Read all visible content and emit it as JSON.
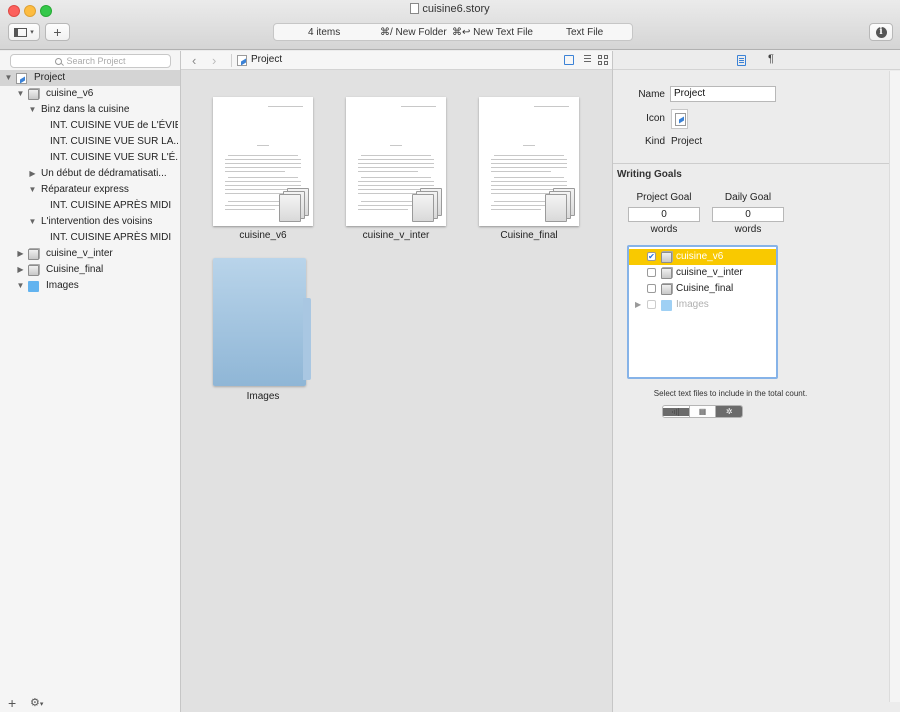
{
  "window": {
    "title": "cuisine6.story"
  },
  "toolbar": {
    "status_items": "4 items",
    "status_new_folder": "⌘/ New Folder",
    "status_new_text": "⌘↩ New Text File",
    "status_kind": "Text File",
    "add_label": "+"
  },
  "sidebar": {
    "search_placeholder": "Search Project",
    "tree": [
      {
        "label": "Project",
        "level": 0,
        "icon": "story-icon",
        "disclosure": "open",
        "selected": true
      },
      {
        "label": "cuisine_v6",
        "level": 1,
        "icon": "stack-icon",
        "disclosure": "open"
      },
      {
        "label": "Binz dans la cuisine",
        "level": 2,
        "icon": "",
        "disclosure": "open"
      },
      {
        "label": "INT. CUISINE VUE de L'ÉVIER",
        "level": 3,
        "icon": "",
        "disclosure": ""
      },
      {
        "label": "INT. CUISINE VUE SUR LA...",
        "level": 3,
        "icon": "",
        "disclosure": ""
      },
      {
        "label": "INT. CUISINE VUE SUR L'É...",
        "level": 3,
        "icon": "",
        "disclosure": ""
      },
      {
        "label": "Un début de dédramatisati...",
        "level": 2,
        "icon": "",
        "disclosure": "closed"
      },
      {
        "label": "Réparateur express",
        "level": 2,
        "icon": "",
        "disclosure": "open"
      },
      {
        "label": "INT. CUISINE APRÈS MIDI",
        "level": 3,
        "icon": "",
        "disclosure": ""
      },
      {
        "label": "L'intervention des voisins",
        "level": 2,
        "icon": "",
        "disclosure": "open"
      },
      {
        "label": "INT. CUISINE APRÈS MIDI",
        "level": 3,
        "icon": "",
        "disclosure": ""
      },
      {
        "label": "cuisine_v_inter",
        "level": 1,
        "icon": "stack-icon",
        "disclosure": "closed"
      },
      {
        "label": "Cuisine_final",
        "level": 1,
        "icon": "stack-icon",
        "disclosure": "closed"
      },
      {
        "label": "Images",
        "level": 1,
        "icon": "folder-icon",
        "disclosure": "open"
      }
    ]
  },
  "browser": {
    "path_label": "Project",
    "items": [
      {
        "label": "cuisine_v6",
        "type": "text-file"
      },
      {
        "label": "cuisine_v_inter",
        "type": "text-file"
      },
      {
        "label": "Cuisine_final",
        "type": "text-file"
      },
      {
        "label": "Images",
        "type": "folder"
      }
    ]
  },
  "inspector": {
    "name_label": "Name",
    "name_value": "Project",
    "icon_label": "Icon",
    "kind_label": "Kind",
    "kind_value": "Project",
    "section_title": "Writing Goals",
    "project_goal_label": "Project Goal",
    "project_goal_value": "0",
    "project_goal_unit": "words",
    "daily_goal_label": "Daily Goal",
    "daily_goal_value": "0",
    "daily_goal_unit": "words",
    "files": [
      {
        "label": "cuisine_v6",
        "checked": true,
        "selected": true,
        "icon": "stack-icon"
      },
      {
        "label": "cuisine_v_inter",
        "checked": false,
        "selected": false,
        "icon": "stack-icon"
      },
      {
        "label": "Cuisine_final",
        "checked": false,
        "selected": false,
        "icon": "stack-icon"
      },
      {
        "label": "Images",
        "checked": false,
        "selected": false,
        "icon": "folder-icon",
        "dimmed": true
      }
    ],
    "help_text": "Select text files to include in the total count.",
    "para_tab": "¶",
    "gear_glyph": "✲"
  },
  "colors": {
    "accent": "#3b82d6",
    "selection_yellow": "#f9c900",
    "folder_blue": "#62b3ef"
  }
}
